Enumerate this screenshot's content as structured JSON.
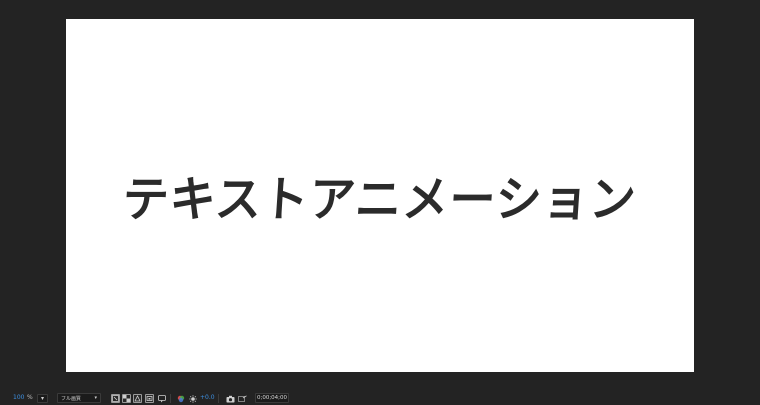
{
  "canvas": {
    "text": "テキストアニメーション",
    "background": "#ffffff",
    "text_color": "#2b2b2b"
  },
  "viewer": {
    "background": "#232323"
  },
  "toolbar": {
    "zoom_value": "100",
    "zoom_unit": "%",
    "zoom_dropdown_icon": "chevron-down-icon",
    "resolution": "フル画質",
    "resolution_dropdown_icon": "chevron-down-icon",
    "icons": [
      "region-of-interest-icon",
      "transparency-grid-icon",
      "mask-visibility-icon",
      "3d-view-icon",
      "snapshot-comment-icon",
      "color-channels-icon",
      "exposure-reset-icon",
      "camera-snapshot-icon",
      "show-snapshot-icon"
    ],
    "exposure_value": "+0.0",
    "timecode": "0;00;04;00",
    "accent_color": "#3d8fe0"
  }
}
